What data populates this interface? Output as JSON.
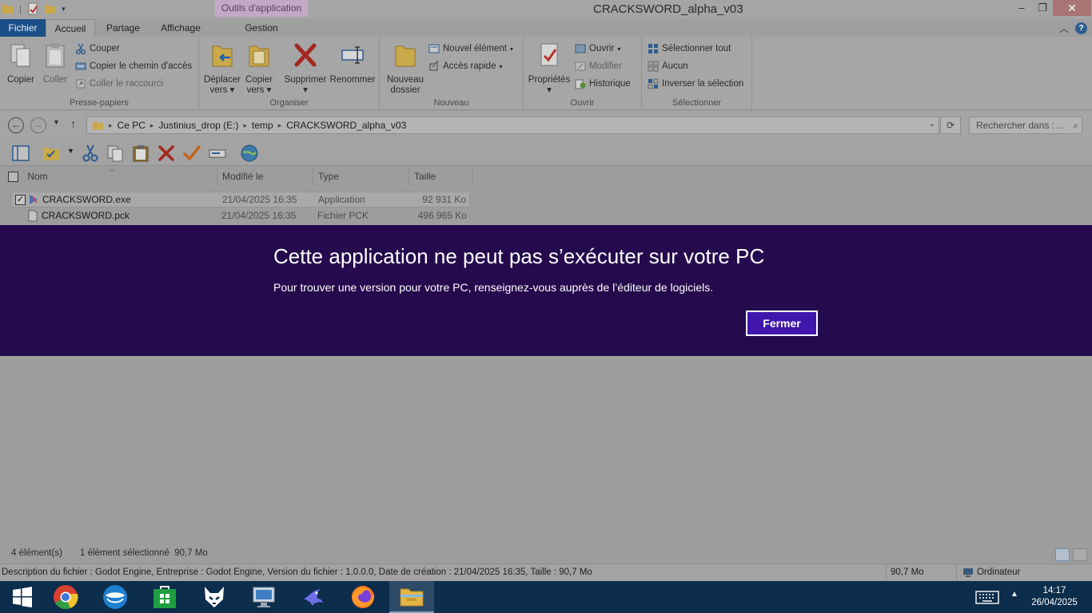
{
  "window": {
    "title": "CRACKSWORD_alpha_v03",
    "context_group": "Outils d'application",
    "minimize": "–",
    "maximize": "❐",
    "close": "✕"
  },
  "tabs": [
    "Fichier",
    "Accueil",
    "Partage",
    "Affichage",
    "Gestion"
  ],
  "ribbon": {
    "clipboard": {
      "label": "Presse-papiers",
      "copy": "Copier",
      "paste": "Coller",
      "cut": "Couper",
      "copy_path": "Copier le chemin d'accès",
      "paste_shortcut": "Coller le raccourci"
    },
    "organize": {
      "label": "Organiser",
      "move_to_1": "Déplacer",
      "move_to_2": "vers",
      "copy_to_1": "Copier",
      "copy_to_2": "vers",
      "delete": "Supprimer",
      "rename": "Renommer"
    },
    "new": {
      "label": "Nouveau",
      "new_folder_1": "Nouveau",
      "new_folder_2": "dossier",
      "new_item": "Nouvel élément",
      "quick_access": "Accès rapide"
    },
    "open": {
      "label": "Ouvrir",
      "properties": "Propriétés",
      "open": "Ouvrir",
      "edit": "Modifier",
      "history": "Historique"
    },
    "select": {
      "label": "Sélectionner",
      "select_all": "Sélectionner tout",
      "select_none": "Aucun",
      "invert": "Inverser la sélection"
    }
  },
  "address": {
    "breadcrumb": [
      "Ce PC",
      "Justinius_drop (E:)",
      "temp",
      "CRACKSWORD_alpha_v03"
    ],
    "search_placeholder": "Rechercher dans : ..."
  },
  "columns": {
    "name": "Nom",
    "modified": "Modifié le",
    "type": "Type",
    "size": "Taille"
  },
  "files": [
    {
      "name": "CRACKSWORD.exe",
      "modified": "21/04/2025 16:35",
      "type": "Application",
      "size": "92 931 Ko",
      "selected": true
    },
    {
      "name": "CRACKSWORD.pck",
      "modified": "21/04/2025 16:35",
      "type": "Fichier PCK",
      "size": "496 965 Ko",
      "selected": false
    }
  ],
  "error": {
    "title": "Cette application ne peut pas s’exécuter sur votre PC",
    "message": "Pour trouver une version pour votre PC, renseignez-vous auprès de l’éditeur de logiciels.",
    "button": "Fermer"
  },
  "status": {
    "count": "4 élément(s)",
    "selection": "1 élément sélectionné  90,7 Mo",
    "description": "Description du fichier : Godot Engine, Entreprise : Godot Engine, Version du fichier : 1.0.0.0, Date de création : 21/04/2025 16:35, Taille : 90,7 Mo",
    "size": "90,7 Mo",
    "location": "Ordinateur"
  },
  "taskbar": {
    "time": "14:17",
    "date": "26/04/2025"
  },
  "colors": {
    "banner": "#250a4d",
    "banner_button": "#4116ad",
    "file_tab": "#1c4f88",
    "taskbar": "#0c2d4b"
  }
}
